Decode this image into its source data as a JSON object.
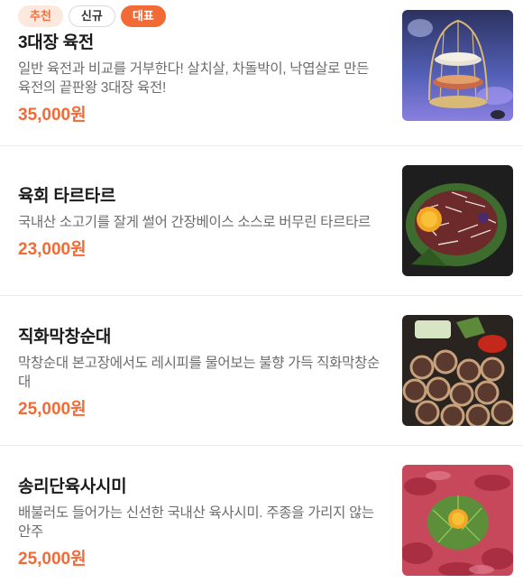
{
  "menu": {
    "items": [
      {
        "badges": [
          "추천",
          "신규",
          "대표"
        ],
        "name": "3대장 육전",
        "description": "일반 육전과 비교를 거부한다! 살치살, 차돌박이, 낙엽살로 만든 육전의 끝판왕 3대장 육전!",
        "price": "35,000원",
        "image": "birdcage-yukjeon-photo"
      },
      {
        "name": "육회 타르타르",
        "description": "국내산 소고기를 잘게 썰어 간장베이스 소스로 버무린 타르타르",
        "price": "23,000원",
        "image": "yukhoe-tartare-photo"
      },
      {
        "name": "직화막창순대",
        "description": "막창순대 본고장에서도 레시피를 물어보는 불향 가득 직화막창순대",
        "price": "25,000원",
        "image": "makchang-sundae-photo"
      },
      {
        "name": "송리단육사시미",
        "description": "배불러도 들어가는 신선한 국내산 육사시미. 주종을 가리지 않는 안주",
        "price": "25,000원",
        "image": "yuk-sashimi-photo"
      }
    ]
  },
  "colors": {
    "accent": "#f26a36",
    "badge_light_bg": "#fde8dd"
  }
}
